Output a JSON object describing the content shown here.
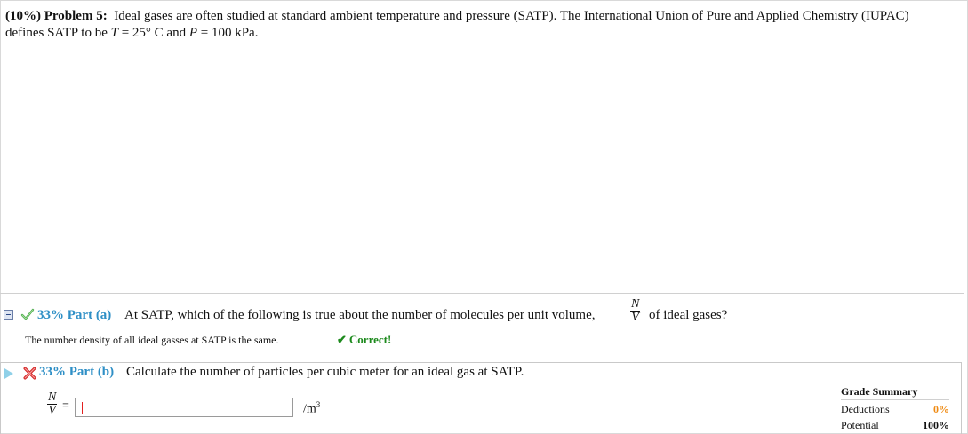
{
  "problem": {
    "weight": "(10%)",
    "label": "Problem 5:",
    "text_1": "Ideal gases are often studied at standard ambient temperature and pressure (SATP). The International Union of Pure and Applied Chemistry (IUPAC) defines SATP to be ",
    "t_var": "T",
    "t_val": " = 25° C and ",
    "p_var": "P",
    "p_val": " = 100 kPa."
  },
  "part_a": {
    "percent_label": "33% Part (a)",
    "question": "At SATP, which of the following is true about the number of molecules per unit volume,",
    "frac_num": "N",
    "frac_den": "V",
    "question_tail": "of ideal gases?",
    "answer": "The number density of all ideal gasses at SATP is the same.",
    "status": "Correct!"
  },
  "part_b": {
    "percent_label": "33% Part (b)",
    "question": "Calculate the number of particles per cubic meter for an ideal gas at SATP.",
    "frac_num": "N",
    "frac_den": "V",
    "equals": "=",
    "input_value": "",
    "unit": "/m",
    "unit_exp": "3"
  },
  "grade_summary": {
    "title": "Grade Summary",
    "deductions_label": "Deductions",
    "deductions_value": "0%",
    "potential_label": "Potential",
    "potential_value": "100%"
  },
  "colors": {
    "part_label": "#2e8fc6",
    "correct": "#1d8a1d",
    "wrong": "#e32020",
    "deductions": "#ef8a12"
  },
  "icons": [
    "collapse-icon",
    "checkmark-icon",
    "correct-check-icon",
    "expand-arrow-icon",
    "x-mark-icon"
  ]
}
